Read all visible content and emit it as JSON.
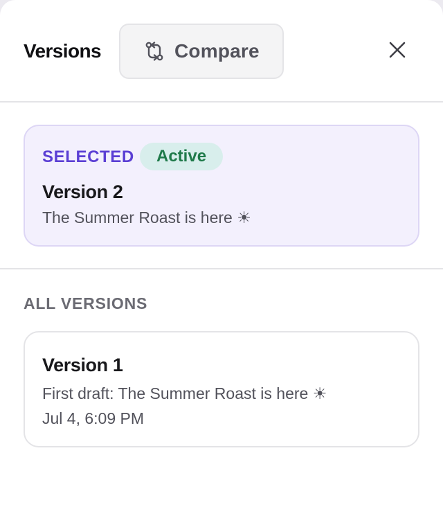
{
  "header": {
    "title": "Versions",
    "compare_label": "Compare",
    "compare_icon": "git-compare-icon",
    "close_icon": "close-icon"
  },
  "selected": {
    "label": "SELECTED",
    "badge": "Active",
    "version_name": "Version 2",
    "description": "The Summer Roast is here ☀"
  },
  "all_versions": {
    "label": "ALL VERSIONS",
    "items": [
      {
        "version_name": "Version 1",
        "description": "First draft: The Summer Roast is here ☀",
        "timestamp": "Jul 4, 6:09 PM"
      }
    ]
  },
  "colors": {
    "accent": "#5b3fd4",
    "selected_bg": "#f3f0fd",
    "badge_bg": "#d8eeec",
    "badge_text": "#1f7a4a"
  }
}
